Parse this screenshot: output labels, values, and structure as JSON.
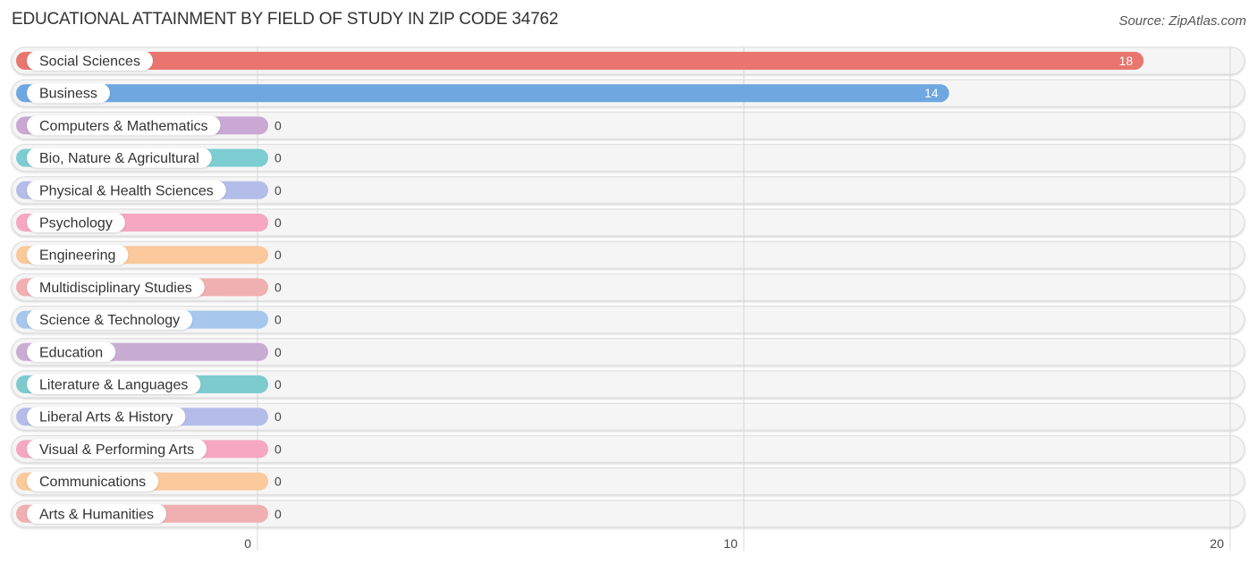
{
  "chart_data": {
    "type": "bar",
    "orientation": "horizontal",
    "title": "EDUCATIONAL ATTAINMENT BY FIELD OF STUDY IN ZIP CODE 34762",
    "source": "Source: ZipAtlas.com",
    "xlabel": "",
    "ylabel": "",
    "xlim": [
      0,
      20
    ],
    "xticks": [
      0,
      10,
      20
    ],
    "grid": true,
    "legend": "none",
    "categories": [
      "Social Sciences",
      "Business",
      "Computers & Mathematics",
      "Bio, Nature & Agricultural",
      "Physical & Health Sciences",
      "Psychology",
      "Engineering",
      "Multidisciplinary Studies",
      "Science & Technology",
      "Education",
      "Literature & Languages",
      "Liberal Arts & History",
      "Visual & Performing Arts",
      "Communications",
      "Arts & Humanities"
    ],
    "values": [
      18,
      14,
      0,
      0,
      0,
      0,
      0,
      0,
      0,
      0,
      0,
      0,
      0,
      0,
      0
    ],
    "colors": [
      "#e8766f",
      "#6fa7e0",
      "#c9a8d3",
      "#7ccdd2",
      "#b4bde9",
      "#f6a7c1",
      "#fbc99b",
      "#f0b0b1",
      "#a7c7ec",
      "#c9acd4",
      "#7dcbcf",
      "#b4bde9",
      "#f6a7c1",
      "#fbc99b",
      "#f0b0b1"
    ]
  }
}
